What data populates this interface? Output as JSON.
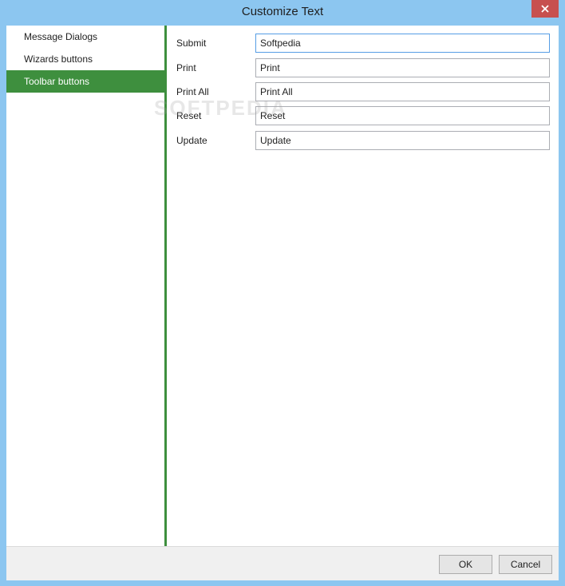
{
  "window": {
    "title": "Customize Text"
  },
  "colors": {
    "accent": "#3e8f3e",
    "close": "#c7504f",
    "frame": "#8cc6f0"
  },
  "sidebar": {
    "items": [
      {
        "label": "Message Dialogs",
        "active": false
      },
      {
        "label": "Wizards buttons",
        "active": false
      },
      {
        "label": "Toolbar buttons",
        "active": true
      }
    ]
  },
  "form": {
    "rows": [
      {
        "label": "Submit",
        "value": "Softpedia"
      },
      {
        "label": "Print",
        "value": "Print"
      },
      {
        "label": "Print All",
        "value": "Print All"
      },
      {
        "label": "Reset",
        "value": "Reset"
      },
      {
        "label": "Update",
        "value": "Update"
      }
    ]
  },
  "footer": {
    "ok_label": "OK",
    "cancel_label": "Cancel"
  },
  "watermark": "SOFTPEDIA"
}
